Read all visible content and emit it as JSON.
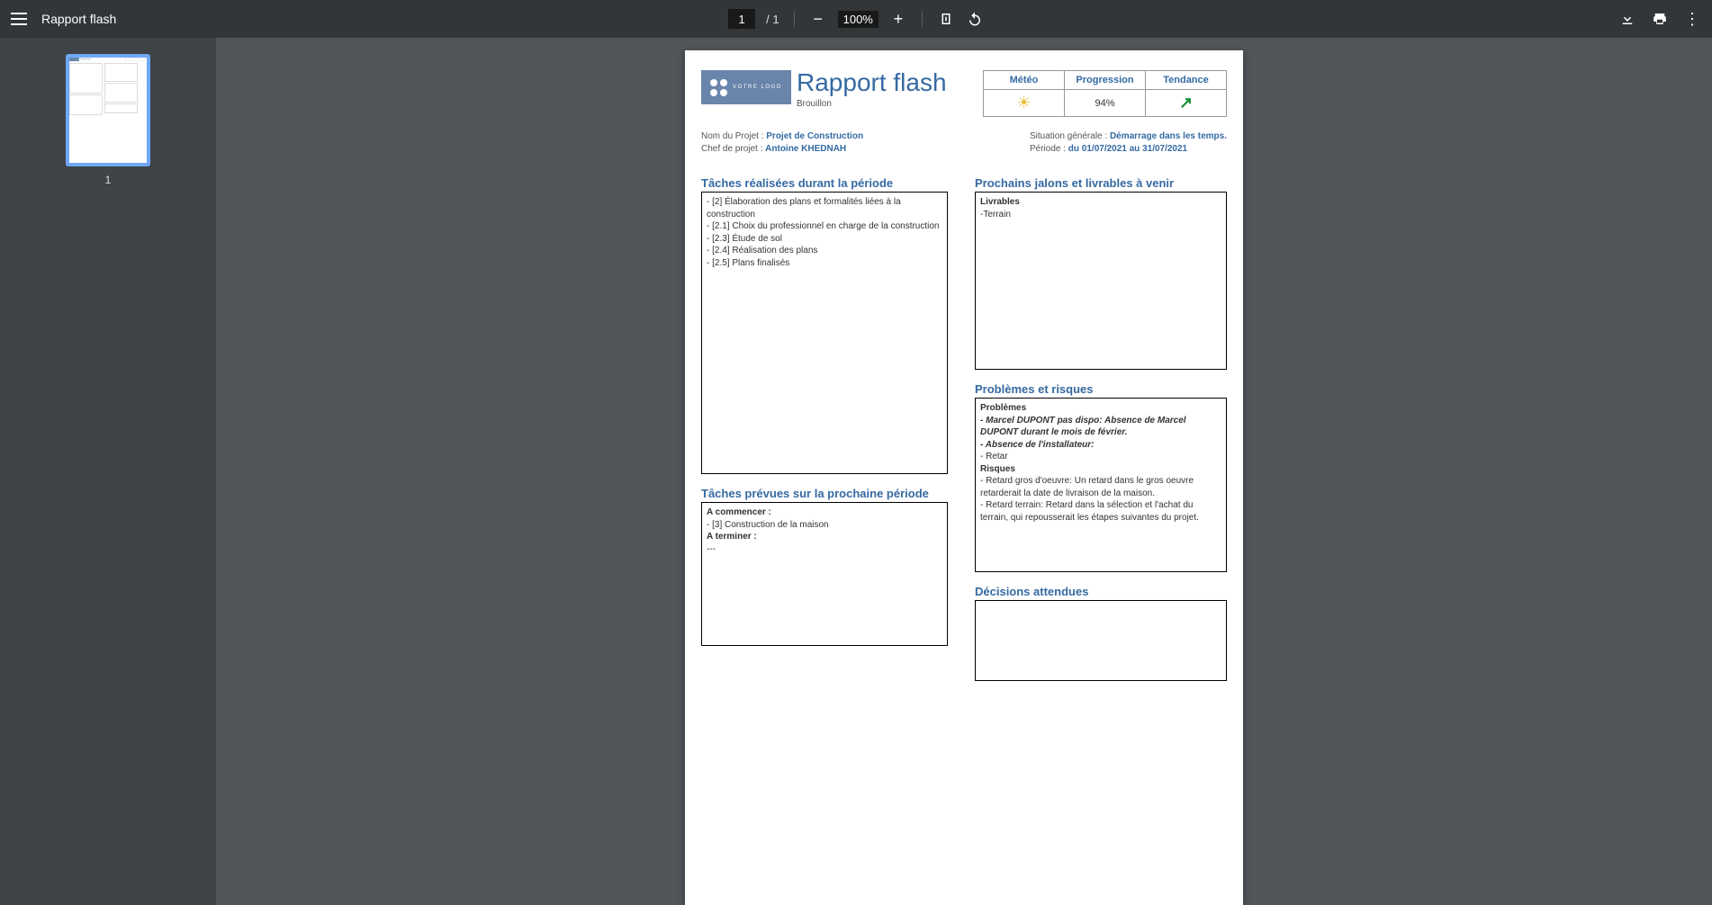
{
  "toolbar": {
    "title": "Rapport flash",
    "page_current": "1",
    "page_total": "1",
    "zoom": "100%"
  },
  "thumbnail": {
    "number": "1"
  },
  "report": {
    "logo_text": "VOTRE LOGO",
    "title": "Rapport flash",
    "subtitle": "Brouillon",
    "status": {
      "meteo_label": "Météo",
      "progression_label": "Progression",
      "tendance_label": "Tendance",
      "progression_value": "94%"
    },
    "meta": {
      "project_label": "Nom du Projet : ",
      "project_value": "Projet de Construction",
      "chef_label": "Chef de projet : ",
      "chef_value": "Antoine KHEDNAH",
      "situation_label": "Situation générale : ",
      "situation_value": "Démarrage dans les temps.",
      "periode_label": "Période : ",
      "periode_value": "du 01/07/2021 au 31/07/2021"
    },
    "sections": {
      "taches_realisees": {
        "title": "Tâches réalisées durant la période",
        "items": [
          "- [2] Élaboration des plans et formalités liées à la construction",
          "  - [2.1] Choix du professionnel en charge de la construction",
          "  - [2.3] Étude de sol",
          "  - [2.4] Réalisation des plans",
          "  - [2.5] Plans finalisés"
        ]
      },
      "taches_prevues": {
        "title": "Tâches prévues sur la prochaine période",
        "a_commencer_label": "A commencer :",
        "a_commencer_items": [
          "- [3] Construction de la maison"
        ],
        "a_terminer_label": "A terminer :",
        "a_terminer_items": [
          "---"
        ]
      },
      "jalons": {
        "title": "Prochains jalons et livrables à venir",
        "livrables_label": "Livrables",
        "livrables_items": [
          "  -Terrain"
        ]
      },
      "problemes": {
        "title": "Problèmes et risques",
        "problemes_label": "Problèmes",
        "problemes_items": [
          "  - Marcel DUPONT pas dispo: Absence de Marcel DUPONT durant le mois de février.",
          "  - Absence de l'installateur:",
          "  - Retar"
        ],
        "risques_label": "Risques",
        "risques_items": [
          "  - Retard gros d'oeuvre: Un retard dans le gros oeuvre retarderait la date de livraison de la maison.",
          "  - Retard terrain: Retard dans la sélection et l'achat du terrain, qui repousserait les étapes suivantes du projet."
        ]
      },
      "decisions": {
        "title": "Décisions attendues"
      }
    }
  }
}
